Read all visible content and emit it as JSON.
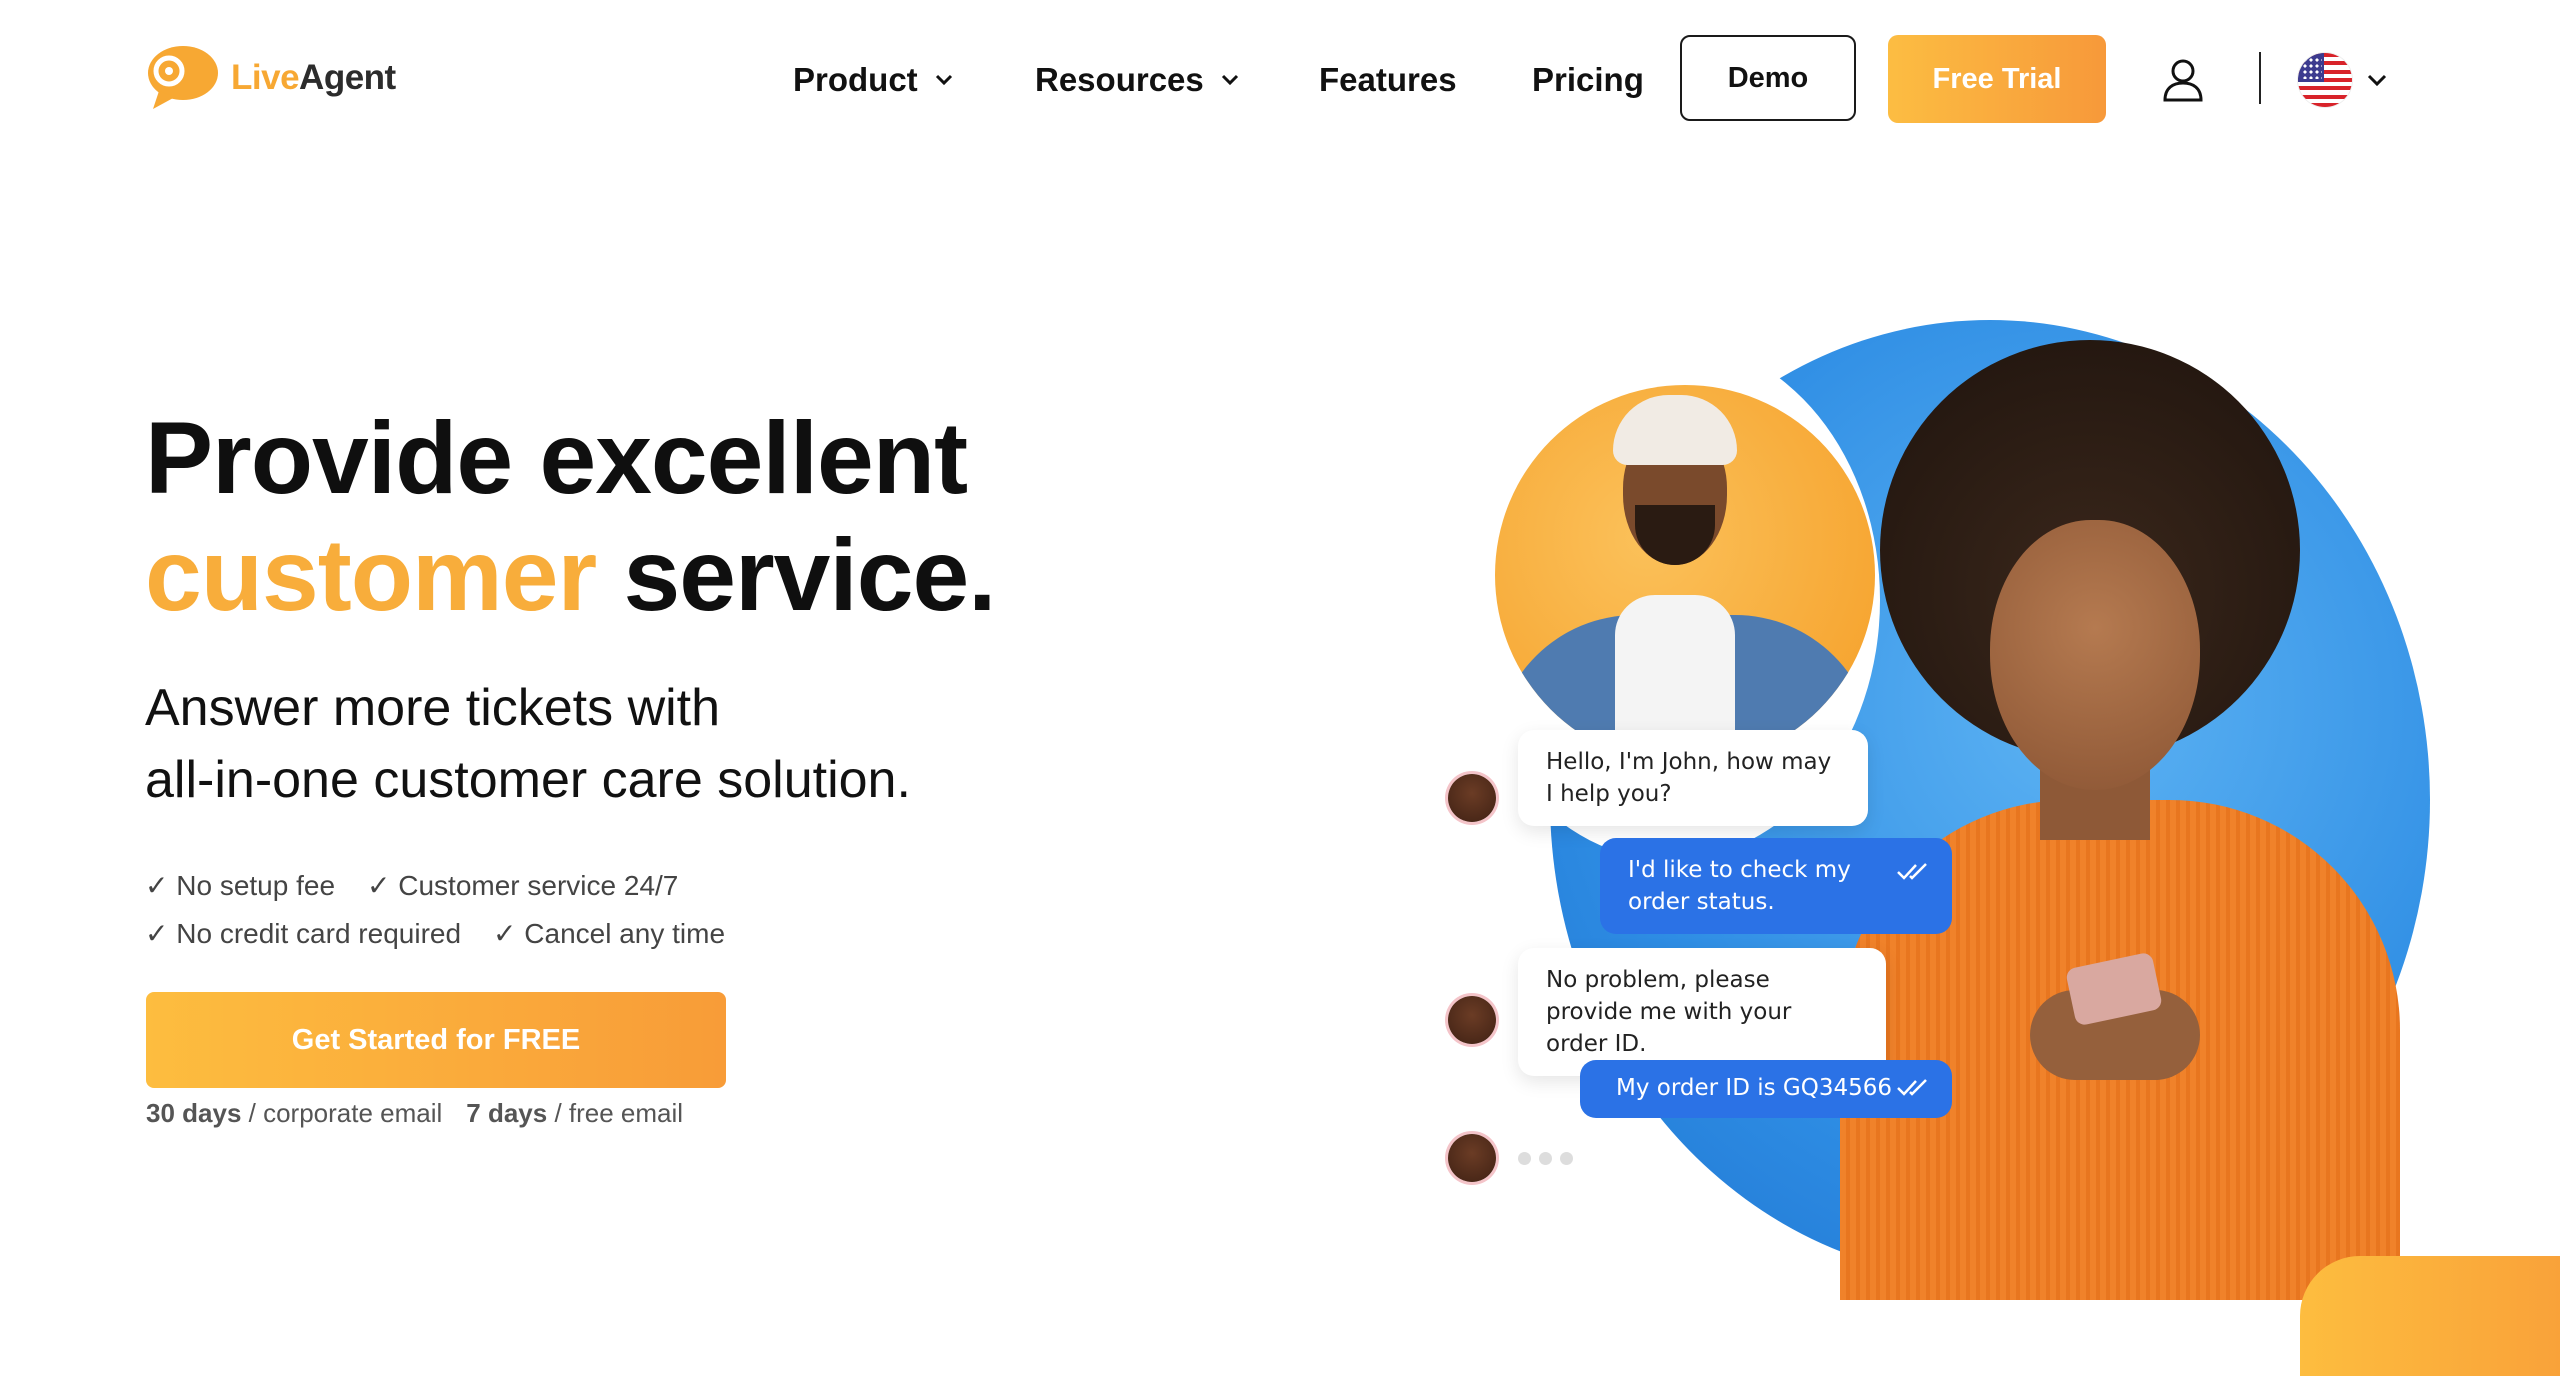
{
  "logo": {
    "live": "Live",
    "agent": "Agent"
  },
  "nav": {
    "product": "Product",
    "resources": "Resources",
    "features": "Features",
    "pricing": "Pricing",
    "demo": "Demo",
    "free_trial": "Free Trial"
  },
  "hero": {
    "title_line1": "Provide excellent",
    "title_accent": "customer",
    "title_rest": " service.",
    "subtitle_line1": "Answer more tickets with",
    "subtitle_line2": "all-in-one customer care solution.",
    "checks": [
      "✓ No setup fee",
      "✓ Customer service 24/7",
      "✓ No credit card required",
      "✓ Cancel any time"
    ],
    "cta": "Get Started for FREE",
    "trial_corporate_days": "30 days",
    "trial_corporate_label": " / corporate email",
    "trial_free_days": "7 days",
    "trial_free_label": " / free email"
  },
  "chat": {
    "msg1": "Hello, I'm John, how may I help you?",
    "msg2": "I'd like to check my order status.",
    "msg3": "No problem, please provide me with your order ID.",
    "msg4": "My order ID is GQ34566"
  },
  "colors": {
    "accent": "#f8ad3b",
    "blue": "#2b72e6"
  },
  "icons": [
    "liveagent-logo-icon",
    "chevron-down-icon",
    "user-icon",
    "us-flag-icon",
    "double-check-icon"
  ]
}
